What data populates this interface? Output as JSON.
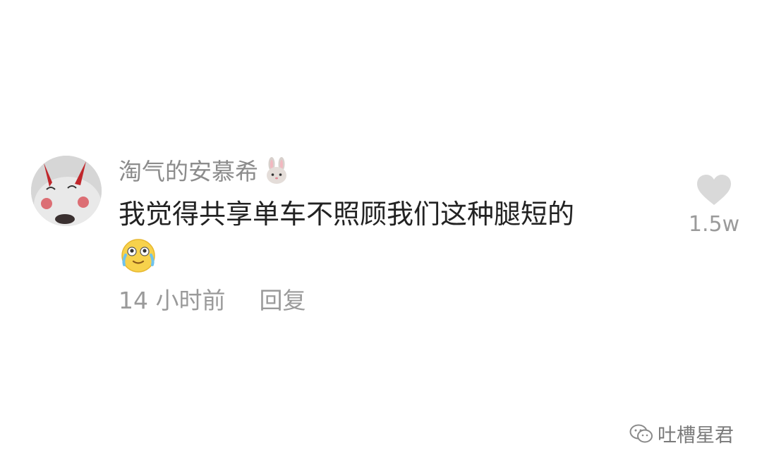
{
  "comment": {
    "username": "淘气的安慕希",
    "username_emoji_icon": "rabbit-face-icon",
    "text": "我觉得共享单车不照顾我们这种腿短的",
    "emoji_icon": "crying-laughing-face-icon",
    "time": "14 小时前",
    "reply_label": "回复"
  },
  "like": {
    "icon": "heart-icon",
    "count": "1.5w",
    "color": "#d9d9d9"
  },
  "watermark": {
    "icon": "wechat-icon",
    "text": "吐槽星君"
  }
}
